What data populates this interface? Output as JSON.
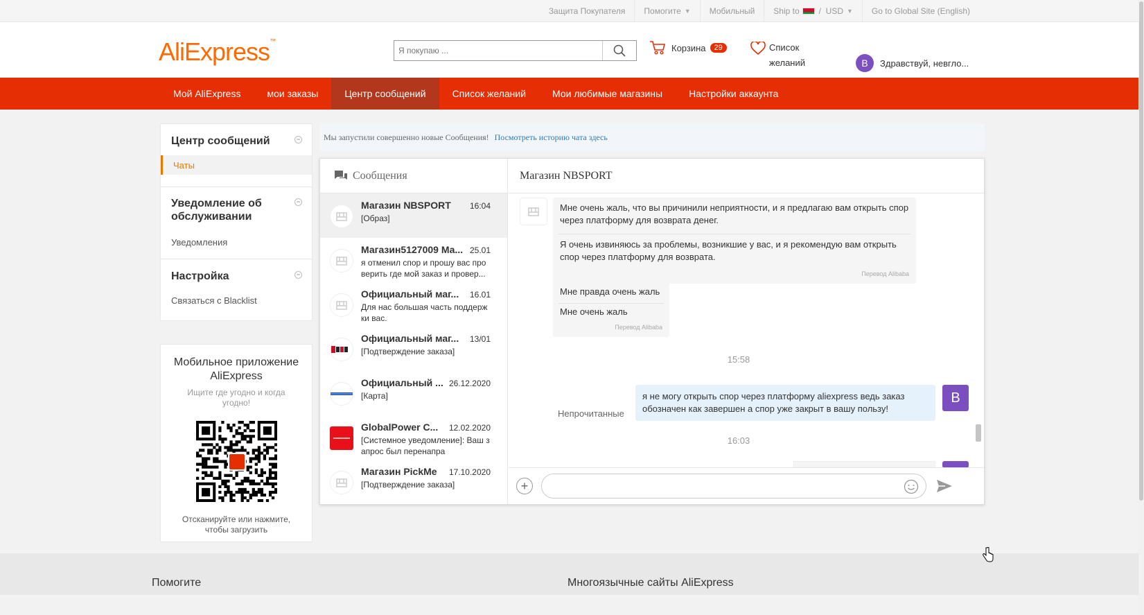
{
  "topbar": {
    "buyer_protection": "Защита Покупателя",
    "help": "Помогите",
    "mobile": "Мобильный",
    "ship_to": "Ship to",
    "currency_sep": "/",
    "currency": "USD",
    "global_site": "Go to Global Site (English)"
  },
  "header": {
    "logo_ali": "AliExpress",
    "search_placeholder": "Я покупаю ...",
    "cart_label": "Корзина",
    "cart_count": "29",
    "wishlist_line1": "Список",
    "wishlist_line2": "желаний",
    "user_initial": "B",
    "user_greeting": "Здравствуй, невгло..."
  },
  "nav": [
    {
      "label": "Мой AliExpress"
    },
    {
      "label": "мои заказы"
    },
    {
      "label": "Центр сообщений",
      "active": true
    },
    {
      "label": "Список желаний"
    },
    {
      "label": "Мои любимые магазины"
    },
    {
      "label": "Настройки аккаунта"
    }
  ],
  "sidebar": {
    "messages_title": "Центр сообщений",
    "chats": "Чаты",
    "service_title_1": "Уведомление об",
    "service_title_2": "обслуживании",
    "notifications": "Уведомления",
    "settings_title": "Настройка",
    "blacklist": "Связаться с Blacklist"
  },
  "mobile_app": {
    "title": "Мобильное приложение AliExpress",
    "subtitle": "Ищите где угодно и когда угодно!",
    "footer_1": "Отсканируйте или нажмите,",
    "footer_2": "чтобы загрузить"
  },
  "banner": {
    "text": "Мы запустили совершенно новые Сообщения!",
    "link": "Посмотреть историю чата здесь"
  },
  "conversations_header": "Сообщения",
  "conversations": [
    {
      "name": "Магазин NBSPORT",
      "date": "16:04",
      "preview": "[Образ]"
    },
    {
      "name": "Магазин5127009 Ма...",
      "date": "25.01",
      "preview": "я отменил спор и прошу вас про верить где мой заказ и провер..."
    },
    {
      "name": "Официальный маг...",
      "date": "16.01",
      "preview": "Для нас большая часть поддерж ки вас."
    },
    {
      "name": "Официальный маг...",
      "date": "13/01",
      "preview": "[Подтверждение заказа]"
    },
    {
      "name": "Официальный ...",
      "date": "26.12.2020",
      "preview": "[Карта]"
    },
    {
      "name": "GlobalPower C...",
      "date": "12.02.2020",
      "preview": "[Системное уведомление]: Ваш з апрос был перенапра"
    },
    {
      "name": "Магазин PickMe",
      "date": "17.10.2020",
      "preview": "[Подтверждение заказа]"
    }
  ],
  "chat": {
    "title": "Магазин NBSPORT",
    "msg1_a": "Мне очень жаль, что вы причинили неприятности, и я предлагаю вам открыть спор через платформу для возврата денег.",
    "msg1_b": "Я очень извиняюсь за проблемы, возникшие у вас, и я рекомендую вам открыть спор через платформу для возврата.",
    "msg1_note": "Перевод Alibaba",
    "msg2_a": "Мне правда очень жаль",
    "msg2_b": "Мне очень жаль",
    "msg2_note": "Перевод Alibaba",
    "time1": "15:58",
    "unread": "Непрочитанные",
    "my_msg": "я не могу открыть спор через платформу aliexpress ведь заказ обозначен как завершен а спор уже закрыт в вашу пользу!",
    "my_initial": "B",
    "time2": "16:03"
  },
  "footer": {
    "help": "Помогите",
    "multilang": "Многоязычные сайты AliExpress"
  },
  "colors": {
    "accent": "#e62e04",
    "active_nav": "#b3371c",
    "avatar": "#7b4fbf"
  }
}
